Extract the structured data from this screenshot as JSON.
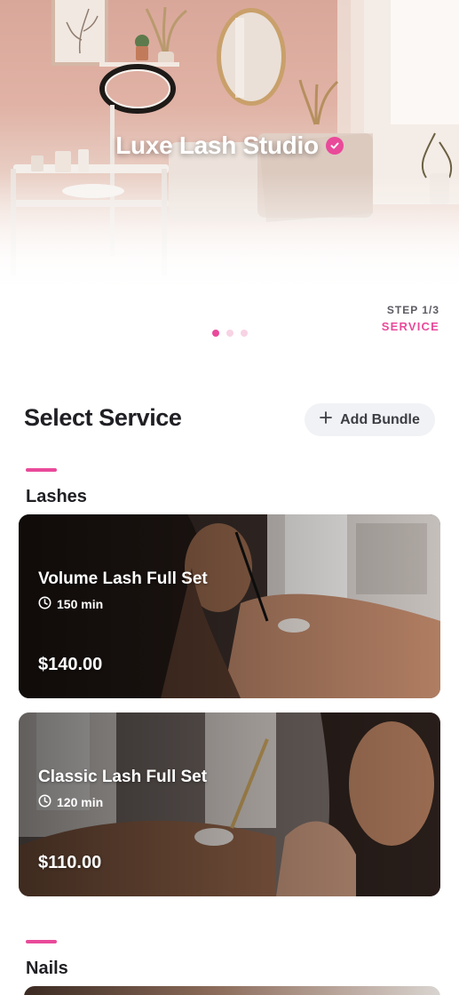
{
  "hero": {
    "studio_name": "Luxe Lash Studio",
    "verified_icon": "verified-check-icon"
  },
  "stepper": {
    "step_count": "STEP 1/3",
    "step_label": "SERVICE",
    "pages": 3,
    "active_page": 1
  },
  "header": {
    "title": "Select Service",
    "add_bundle_label": "Add Bundle",
    "add_bundle_icon": "plus-icon"
  },
  "categories": [
    {
      "label": "Lashes",
      "services": [
        {
          "name": "Volume Lash Full Set",
          "duration": "150 min",
          "price": "$140.00"
        },
        {
          "name": "Classic Lash Full Set",
          "duration": "120 min",
          "price": "$110.00"
        }
      ]
    },
    {
      "label": "Nails",
      "services": []
    }
  ],
  "colors": {
    "accent": "#e94a9a",
    "text": "#1f1f24",
    "button_bg": "#f1f2f5"
  }
}
